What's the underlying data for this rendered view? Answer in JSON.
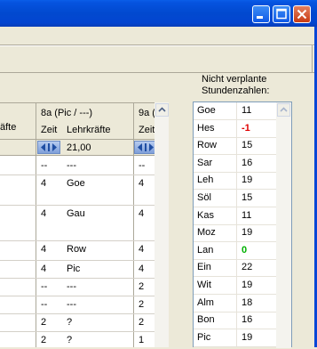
{
  "window": {
    "minimize_icon": "minimize-icon",
    "maximize_icon": "maximize-icon",
    "close_icon": "close-icon"
  },
  "grid": {
    "left_header_fragment": "äfte",
    "columns": [
      {
        "class_label": "8a  (Pic / ---)",
        "zeit": "Zeit",
        "lehrkraefte": "Lehrkräfte",
        "total": "21,00"
      },
      {
        "class_label": "9a  (",
        "zeit": "Zeit"
      }
    ],
    "rows": [
      {
        "z1": "--",
        "l1": "---",
        "z2": "--"
      },
      {
        "z1": "4",
        "l1": "Goe",
        "z2": "4"
      },
      {
        "z1": "4",
        "l1": "Gau",
        "z2": "4"
      },
      {
        "z1": "4",
        "l1": "Row",
        "z2": "4"
      },
      {
        "z1": "4",
        "l1": "Pic",
        "z2": "4"
      },
      {
        "z1": "--",
        "l1": "---",
        "z2": "2"
      },
      {
        "z1": "--",
        "l1": "---",
        "z2": "2"
      },
      {
        "z1": "2",
        "l1": "?",
        "z2": "2"
      },
      {
        "z1": "2",
        "l1": "?",
        "z2": "1"
      }
    ]
  },
  "side": {
    "heading_line1": "Nicht verplante",
    "heading_line2": "Stundenzahlen:",
    "items": [
      {
        "name": "Goe",
        "value": "11"
      },
      {
        "name": "Hes",
        "value": "-1"
      },
      {
        "name": "Row",
        "value": "15"
      },
      {
        "name": "Sar",
        "value": "16"
      },
      {
        "name": "Leh",
        "value": "19"
      },
      {
        "name": "Söl",
        "value": "15"
      },
      {
        "name": "Kas",
        "value": "11"
      },
      {
        "name": "Moz",
        "value": "19"
      },
      {
        "name": "Lan",
        "value": "0"
      },
      {
        "name": "Ein",
        "value": "22"
      },
      {
        "name": "Wit",
        "value": "19"
      },
      {
        "name": "Alm",
        "value": "18"
      },
      {
        "name": "Bon",
        "value": "16"
      },
      {
        "name": "Pic",
        "value": "19"
      }
    ],
    "colors": {
      "negative": "#e00000",
      "zero": "#00b000"
    }
  }
}
